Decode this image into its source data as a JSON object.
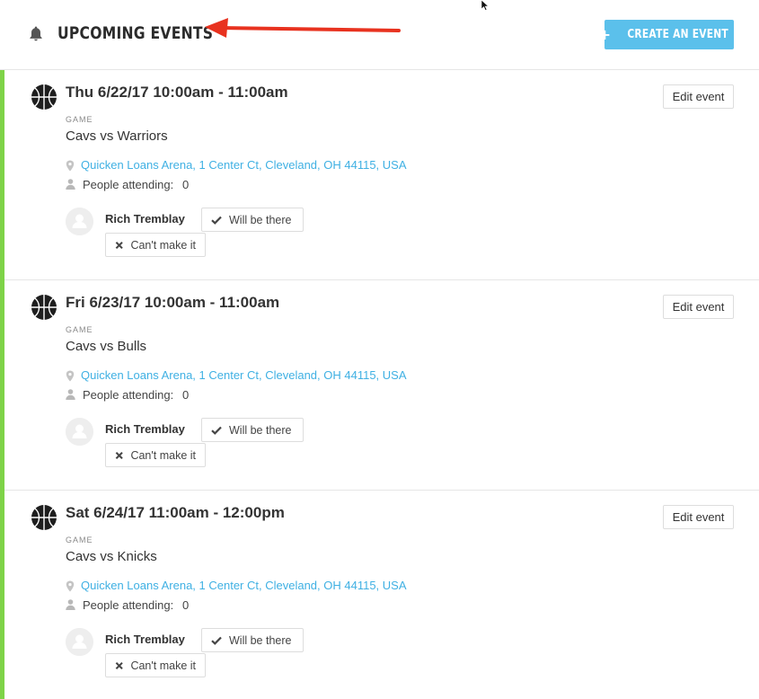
{
  "header": {
    "title": "UPCOMING EVENTS",
    "create_label": "CREATE AN EVENT",
    "create_icon": "plus-icon"
  },
  "colors": {
    "accent": "#5bc0eb",
    "link": "#3fb0e3",
    "status_bar": "#7ed348",
    "annotation_arrow": "#e8321f"
  },
  "events": [
    {
      "when": "Thu 6/22/17 10:00am - 11:00am",
      "kind": "GAME",
      "name": "Cavs vs Warriors",
      "location": "Quicken Loans Arena, 1 Center Ct, Cleveland, OH 44115, USA",
      "attending_label": "People attending:",
      "attending_count": "0",
      "edit_label": "Edit event",
      "person": "Rich Tremblay",
      "yes_label": "Will be there",
      "no_label": "Can't make it"
    },
    {
      "when": "Fri 6/23/17 10:00am - 11:00am",
      "kind": "GAME",
      "name": "Cavs vs Bulls",
      "location": "Quicken Loans Arena, 1 Center Ct, Cleveland, OH 44115, USA",
      "attending_label": "People attending:",
      "attending_count": "0",
      "edit_label": "Edit event",
      "person": "Rich Tremblay",
      "yes_label": "Will be there",
      "no_label": "Can't make it"
    },
    {
      "when": "Sat 6/24/17 11:00am - 12:00pm",
      "kind": "GAME",
      "name": "Cavs vs Knicks",
      "location": "Quicken Loans Arena, 1 Center Ct, Cleveland, OH 44115, USA",
      "attending_label": "People attending:",
      "attending_count": "0",
      "edit_label": "Edit event",
      "person": "Rich Tremblay",
      "yes_label": "Will be there",
      "no_label": "Can't make it"
    }
  ]
}
